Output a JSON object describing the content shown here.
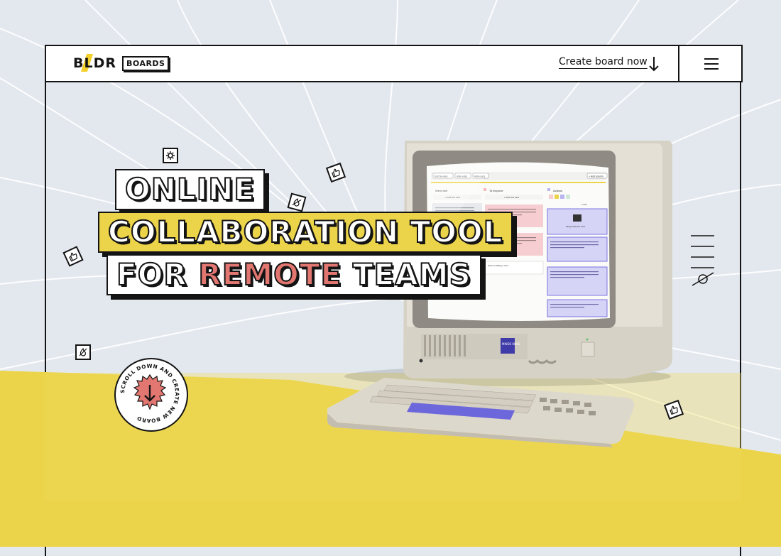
{
  "header": {
    "logo_text": "BLDR",
    "logo_badge": "BOARDS",
    "create_label": "Create board now"
  },
  "hero": {
    "line1": "ONLINE",
    "line2": "COLLABORATION TOOL",
    "line3_a": "FOR ",
    "line3_red": "REMOTE",
    "line3_b": " TEAMS"
  },
  "scroll_badge": {
    "text": "SCROLL DOWN AND CREATE NEW BOARD"
  },
  "screen": {
    "toolbar_buttons": [
      "Sort by votes",
      "Hide votes",
      "Hide users"
    ],
    "add_column": "+ Add column",
    "columns": [
      {
        "title": "Went well",
        "add": "+ Add new card"
      },
      {
        "title": "To improve",
        "add": "+ Add new card"
      },
      {
        "title": "Actions",
        "add": "+ card"
      }
    ],
    "card_text": "Lorem Ipsum is simply dummy text of the printing and typesetting industry.",
    "merge_text": "Merge with this card",
    "typing_text": "Hello is adding a card",
    "brand": "MINDS KNBS"
  },
  "colors": {
    "yellow": "#ecd44a",
    "red": "#e27670",
    "bg": "#e3e8ef",
    "ink": "#141414",
    "purple": "#7a74e0"
  },
  "icons": [
    "gear-icon",
    "thumbs-up-icon",
    "no-fire-icon",
    "hamburger-icon",
    "arrow-down-icon"
  ]
}
